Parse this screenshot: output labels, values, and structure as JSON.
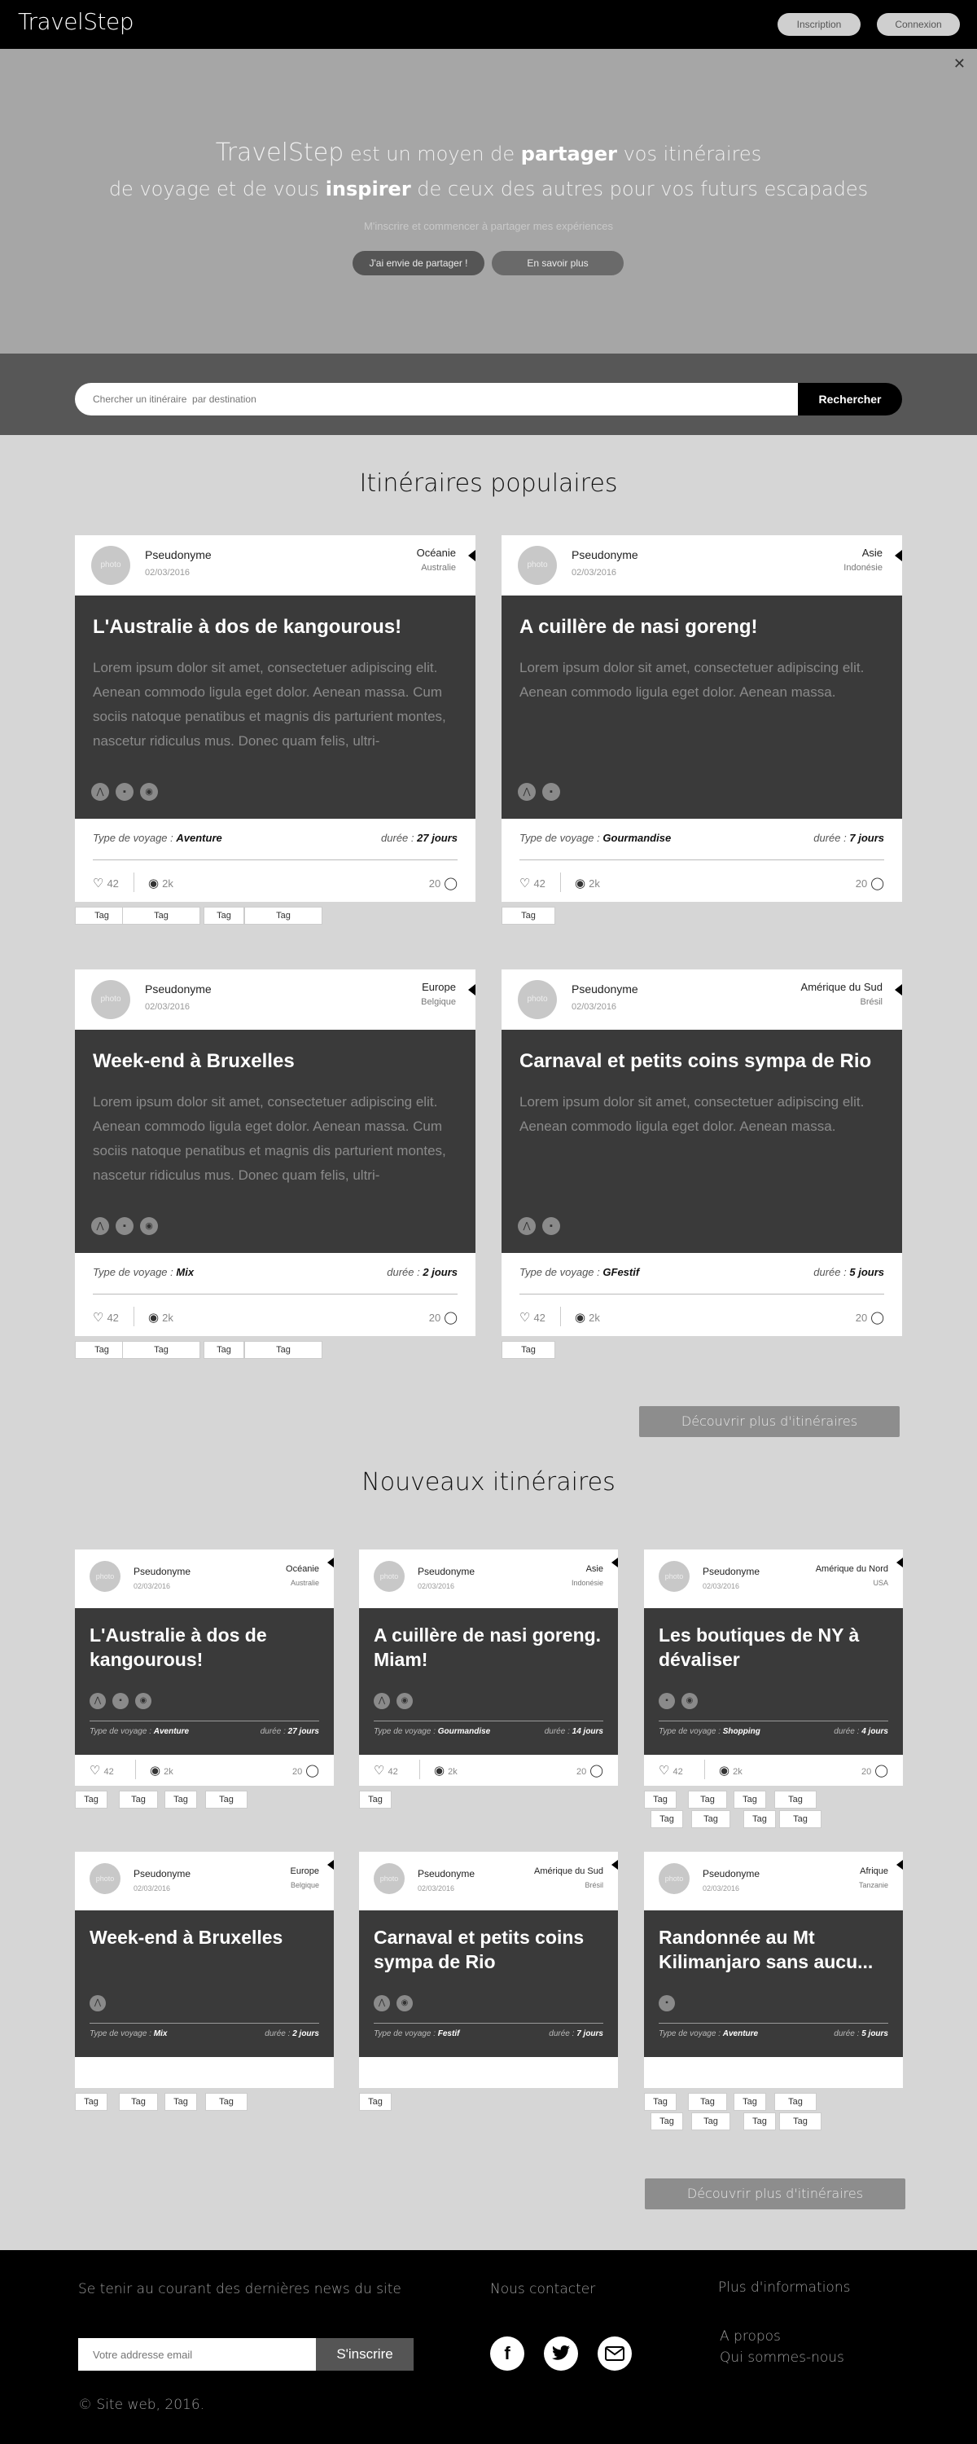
{
  "header": {
    "logo": "TravelStep",
    "signup": "Inscription",
    "login": "Connexion"
  },
  "hero": {
    "close": "✕",
    "brand": "TravelStep",
    "l1_a": " est un moyen de ",
    "l1_b": "partager",
    "l1_c": " vos itinéraires",
    "l2_a": "de voyage et de vous ",
    "l2_b": "inspirer",
    "l2_c": " de ceux des autres pour vos futurs escapades",
    "sub": "M'inscrire et commencer à partager mes expériences",
    "cta_share": "J'ai envie de partager !",
    "cta_more": "En savoir plus"
  },
  "search": {
    "placeholder": "Chercher un itinéraire  par destination",
    "button": "Rechercher"
  },
  "popular": {
    "title": "Itinéraires populaires",
    "cards": [
      {
        "pseudo": "Pseudonyme",
        "date": "02/03/2016",
        "region": "Océanie",
        "country": "Australie",
        "title": "L'Australie à dos de kangourous!",
        "desc": "Lorem ipsum dolor sit amet, consectetuer adipiscing elit. Aenean commodo ligula eget dolor. Aenean massa. Cum sociis natoque penatibus et magnis dis parturient montes, nascetur ridiculus mus. Donec quam felis, ultri-",
        "icons": [
          "walk-icon",
          "food-icon",
          "camera-icon"
        ],
        "type_label": "Type de voyage :",
        "type": "Aventure",
        "dur_label": "durée :",
        "duration": "27 jours",
        "likes": "42",
        "views": "2k",
        "comments": "20",
        "tags": [
          "Tag",
          "Tag",
          "Tag",
          "Tag"
        ]
      },
      {
        "pseudo": "Pseudonyme",
        "date": "02/03/2016",
        "region": "Asie",
        "country": "Indonésie",
        "title": "A cuillère de nasi goreng!",
        "desc": "Lorem ipsum dolor sit amet, consectetuer adipiscing elit. Aenean commodo ligula eget dolor. Aenean massa.",
        "icons": [
          "walk-icon",
          "food-icon"
        ],
        "type_label": "Type de voyage :",
        "type": "Gourmandise",
        "dur_label": "durée :",
        "duration": "7 jours",
        "likes": "42",
        "views": "2k",
        "comments": "20",
        "tags": [
          "Tag"
        ]
      },
      {
        "pseudo": "Pseudonyme",
        "date": "02/03/2016",
        "region": "Europe",
        "country": "Belgique",
        "title": "Week-end à Bruxelles",
        "desc": "Lorem ipsum dolor sit amet, consectetuer adipiscing elit. Aenean commodo ligula eget dolor. Aenean massa. Cum sociis natoque penatibus et magnis dis parturient montes, nascetur ridiculus mus. Donec quam felis, ultri-",
        "icons": [
          "walk-icon",
          "food-icon",
          "camera-icon"
        ],
        "type_label": "Type de voyage :",
        "type": "Mix",
        "dur_label": "durée :",
        "duration": "2 jours",
        "likes": "42",
        "views": "2k",
        "comments": "20",
        "tags": [
          "Tag",
          "Tag",
          "Tag",
          "Tag"
        ]
      },
      {
        "pseudo": "Pseudonyme",
        "date": "02/03/2016",
        "region": "Amérique du Sud",
        "country": "Brésil",
        "title": "Carnaval et petits coins sympa de Rio",
        "desc": "Lorem ipsum dolor sit amet, consectetuer adipiscing elit. Aenean commodo ligula eget dolor. Aenean massa.",
        "icons": [
          "walk-icon",
          "food-icon"
        ],
        "type_label": "Type de voyage :",
        "type": "GFestif",
        "dur_label": "durée :",
        "duration": "5 jours",
        "likes": "42",
        "views": "2k",
        "comments": "20",
        "tags": [
          "Tag"
        ]
      }
    ],
    "more": "Découvrir plus d'itinéraires"
  },
  "recent": {
    "title": "Nouveaux itinéraires",
    "cards": [
      {
        "pseudo": "Pseudonyme",
        "date": "02/03/2016",
        "region": "Océanie",
        "country": "Australie",
        "title": "L'Australie à dos de kangourous!",
        "icons": [
          "walk-icon",
          "food-icon",
          "camera-icon"
        ],
        "type_label": "Type de voyage :",
        "type": "Aventure",
        "dur_label": "durée :",
        "duration": "27 jours",
        "likes": "42",
        "views": "2k",
        "comments": "20",
        "tags": [
          "Tag",
          "Tag",
          "Tag",
          "Tag"
        ]
      },
      {
        "pseudo": "Pseudonyme",
        "date": "02/03/2016",
        "region": "Asie",
        "country": "Indonésie",
        "title": "A cuillère de nasi goreng. Miam!",
        "icons": [
          "walk-icon",
          "camera-icon"
        ],
        "type_label": "Type de voyage :",
        "type": "Gourmandise",
        "dur_label": "durée :",
        "duration": "14 jours",
        "likes": "42",
        "views": "2k",
        "comments": "20",
        "tags": [
          "Tag"
        ]
      },
      {
        "pseudo": "Pseudonyme",
        "date": "02/03/2016",
        "region": "Amérique du Nord",
        "country": "USA",
        "title": "Les boutiques de NY à dévaliser",
        "icons": [
          "food-icon",
          "camera-icon"
        ],
        "type_label": "Type de voyage :",
        "type": "Shopping",
        "dur_label": "durée :",
        "duration": "4 jours",
        "likes": "42",
        "views": "2k",
        "comments": "20",
        "tags": [
          "Tag",
          "Tag",
          "Tag",
          "Tag",
          "Tag",
          "Tag",
          "Tag",
          "Tag"
        ]
      },
      {
        "pseudo": "Pseudonyme",
        "date": "02/03/2016",
        "region": "Europe",
        "country": "Belgique",
        "title": "Week-end à Bruxelles",
        "icons": [
          "walk-icon"
        ],
        "type_label": "Type de voyage :",
        "type": "Mix",
        "dur_label": "durée :",
        "duration": "2 jours",
        "tags": [
          "Tag",
          "Tag",
          "Tag",
          "Tag"
        ]
      },
      {
        "pseudo": "Pseudonyme",
        "date": "02/03/2016",
        "region": "Amérique du Sud",
        "country": "Brésil",
        "title": "Carnaval et petits coins sympa de Rio",
        "icons": [
          "walk-icon",
          "camera-icon"
        ],
        "type_label": "Type de voyage :",
        "type": "Festif",
        "dur_label": "durée :",
        "duration": "7 jours",
        "tags": [
          "Tag"
        ]
      },
      {
        "pseudo": "Pseudonyme",
        "date": "02/03/2016",
        "region": "Afrique",
        "country": "Tanzanie",
        "title": "Randonnée au Mt Kilimanjaro sans aucu...",
        "icons": [
          "food-icon"
        ],
        "type_label": "Type de voyage :",
        "type": "Aventure",
        "dur_label": "durée :",
        "duration": "5 jours",
        "tags": [
          "Tag",
          "Tag",
          "Tag",
          "Tag",
          "Tag",
          "Tag",
          "Tag",
          "Tag"
        ]
      }
    ],
    "more": "Découvrir plus d'itinéraires"
  },
  "footer": {
    "news": "Se tenir au courant des dernières news du site",
    "email_placeholder": "Votre addresse email",
    "subscribe": "S'inscrire",
    "contact": "Nous contacter",
    "more_info": "Plus d'informations",
    "about": "A propos",
    "who": "Qui sommes-nous",
    "copyright": "© Site web, 2016."
  },
  "colors": {
    "dark_card": "#3a3a3a",
    "page_bg": "#d6d6d6",
    "hero_bg": "#a6a6a6"
  }
}
